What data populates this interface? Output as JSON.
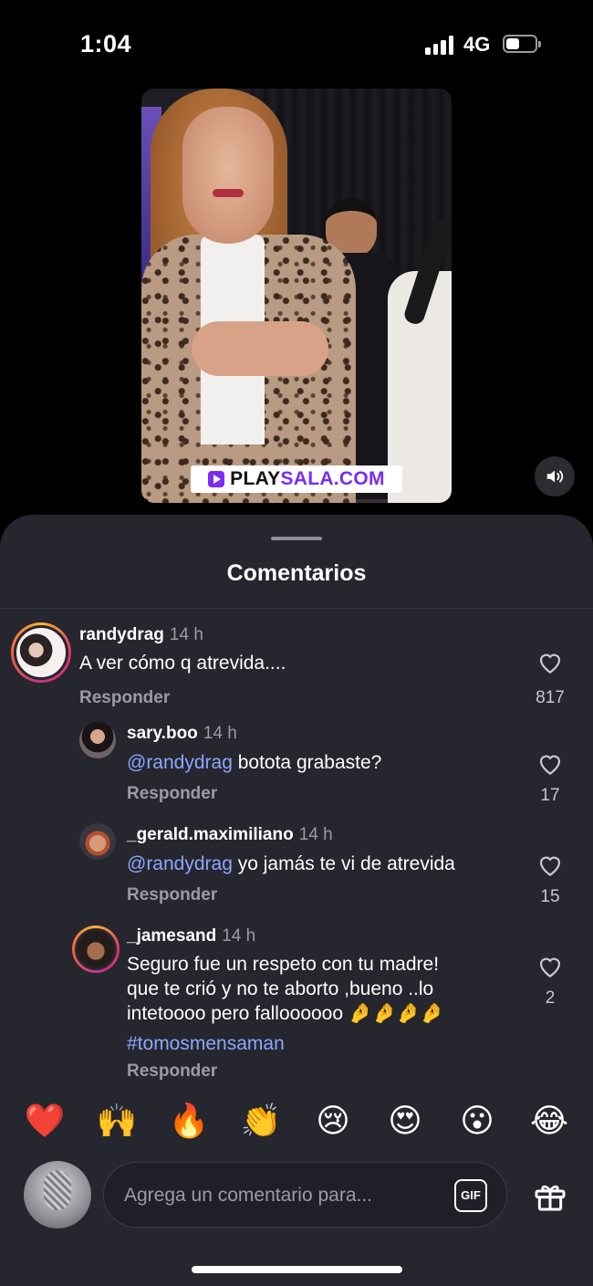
{
  "status": {
    "time": "1:04",
    "network": "4G",
    "battery_level": 0.35
  },
  "video": {
    "watermark_play": "PLAY",
    "watermark_sala": "SALA.COM"
  },
  "sheet": {
    "title": "Comentarios"
  },
  "comments": [
    {
      "username": "randydrag",
      "time": "14 h",
      "mention": "",
      "text": "A ver cómo q atrevida....",
      "reply_label": "Responder",
      "likes": "817"
    },
    {
      "username": "sary.boo",
      "time": "14 h",
      "mention": "@randydrag",
      "text": " bototа grabaste?",
      "reply_label": "Responder",
      "likes": "17"
    },
    {
      "username": "_gerald.maximiliano",
      "time": "14 h",
      "mention": "@randydrag",
      "text": " yo jamás te vi de atrevida",
      "reply_label": "Responder",
      "likes": "15"
    },
    {
      "username": "_jamesand",
      "time": "14 h",
      "mention": "",
      "text_line1": "Seguro fue un respeto con tu madre!",
      "text_line2": "que te crió y no te aborto ,bueno ..lo",
      "text_line3": "intetoooo pero falloooooo 🤌🤌🤌🤌",
      "hashtag": "#tomosmensaman",
      "reply_label": "Responder",
      "likes": "2"
    }
  ],
  "emoji_bar": [
    "❤️",
    "🙌",
    "🔥",
    "👏",
    "😢",
    "😍",
    "😮",
    "😂"
  ],
  "composer": {
    "placeholder": "Agrega un comentario para...",
    "gif_label": "GIF"
  }
}
